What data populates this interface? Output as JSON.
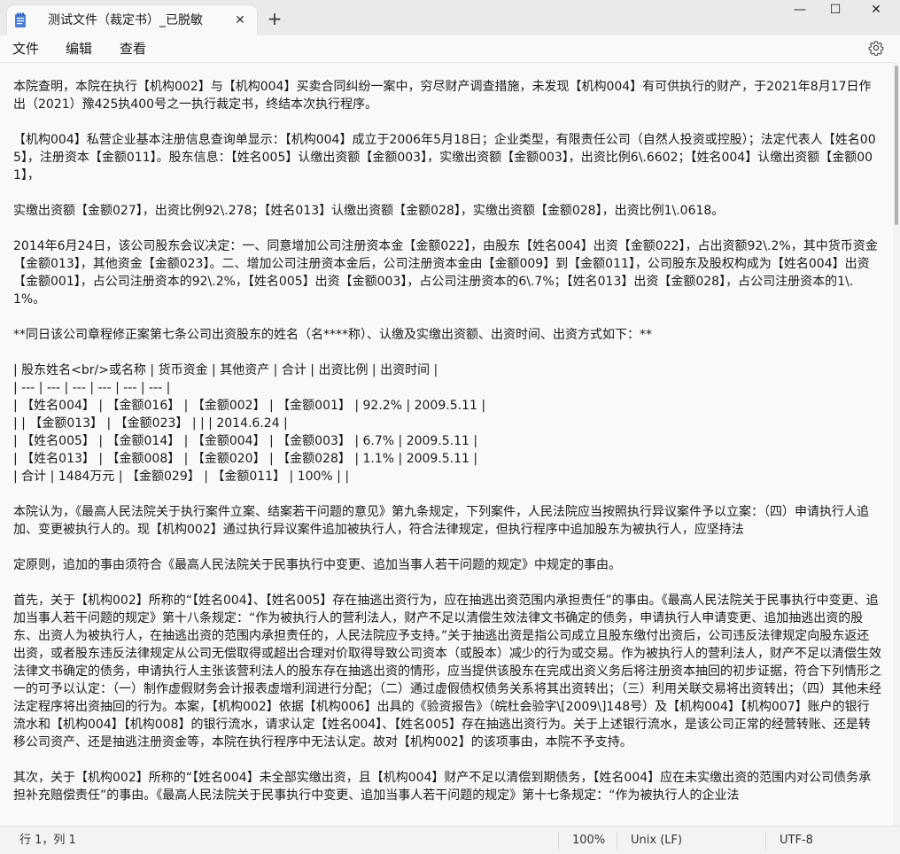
{
  "tab": {
    "title": "测试文件（裁定书）_已脱敏"
  },
  "window_controls": {
    "minimize": "—",
    "maximize": "☐",
    "close": "✕",
    "new_tab": "+",
    "tab_close": "✕"
  },
  "menu": {
    "file": "文件",
    "edit": "编辑",
    "view": "查看"
  },
  "icons": {
    "document": "notepad-document-icon",
    "settings": "gear-icon"
  },
  "document": {
    "paragraphs": [
      "本院查明，本院在执行【机构002】与【机构004】买卖合同纠纷一案中，穷尽财产调查措施，未发现【机构004】有可供执行的财产，于2021年8月17日作出（2021）豫425执400号之一执行裁定书，终结本次执行程序。",
      "【机构004】私营企业基本注册信息查询单显示：【机构004】成立于2006年5月18日；企业类型，有限责任公司（自然人投资或控股）；法定代表人【姓名005】，注册资本【金额011】。股东信息：【姓名005】认缴出资额【金额003】，实缴出资额【金额003】，出资比例6\\.6602；【姓名004】认缴出资额【金额001】，",
      "实缴出资额【金额027】，出资比例92\\.278；【姓名013】认缴出资额【金额028】，实缴出资额【金额028】，出资比例1\\.0618。",
      "2014年6月24日，该公司股东会议决定：一、同意增加公司注册资本金【金额022】，由股东【姓名004】出资【金额022】，占出资额92\\.2%，其中货币资金【金额013】，其他资金【金额023】。二、增加公司注册资本金后，公司注册资本金由【金额009】到【金额011】，公司股东及股权构成为【姓名004】出资【金额001】，占公司注册资本的92\\.2%，【姓名005】出资【金额003】，占公司注册资本的6\\.7%；【姓名013】出资【金额028】，占公司注册资本的1\\.1%。",
      "**同日该公司章程修正案第七条公司出资股东的姓名（名****称）、认缴及实缴出资额、出资时间、出资方式如下：**"
    ],
    "table_lines": [
      "| 股东姓名<br/>或名称 | 货币资金 | 其他资产 | 合计 | 出资比例 | 出资时间 |",
      "| --- | --- | --- | --- | --- | --- |",
      "| 【姓名004】 | 【金额016】 | 【金额002】 | 【金额001】 | 92.2% | 2009.5.11 |",
      "| | 【金额013】 | 【金额023】 | | | 2014.6.24 |",
      "| 【姓名005】 | 【金额014】 | 【金额004】 | 【金额003】 | 6.7% | 2009.5.11 |",
      "| 【姓名013】 | 【金额008】 | 【金额020】 | 【金额028】 | 1.1% | 2009.5.11 |",
      "| 合计 | 1484万元 | 【金额029】 | 【金额011】 | 100% | |"
    ],
    "paragraphs_after": [
      "本院认为，《最高人民法院关于执行案件立案、结案若干问题的意见》第九条规定，下列案件，人民法院应当按照执行异议案件予以立案：（四）申请执行人追加、变更被执行人的。现【机构002】通过执行异议案件追加被执行人，符合法律规定，但执行程序中追加股东为被执行人，应坚持法",
      "定原则，追加的事由须符合《最高人民法院关于民事执行中变更、追加当事人若干问题的规定》中规定的事由。",
      "首先，关于【机构002】所称的“【姓名004】、【姓名005】存在抽逃出资行为，应在抽逃出资范围内承担责任”的事由。《最高人民法院关于民事执行中变更、追加当事人若干问题的规定》第十八条规定：“作为被执行人的营利法人，财产不足以清偿生效法律文书确定的债务，申请执行人申请变更、追加抽逃出资的股东、出资人为被执行人，在抽逃出资的范围内承担责任的，人民法院应予支持。”关于抽逃出资是指公司成立且股东缴付出资后，公司违反法律规定向股东返还出资，或者股东违反法律规定从公司无偿取得或超出合理对价取得导致公司资本（或股本）减少的行为或交易。作为被执行人的营利法人，财产不足以清偿生效法律文书确定的债务，申请执行人主张该营利法人的股东存在抽逃出资的情形，应当提供该股东在完成出资义务后将注册资本抽回的初步证据，符合下列情形之一的可予以认定：（一）制作虚假财务会计报表虚增利润进行分配；（二）通过虚假债权债务关系将其出资转出；（三）利用关联交易将出资转出；（四）其他未经法定程序将出资抽回的行为。本案，【机构002】依据【机构006】出具的《验资报告》（皖杜会验字\\[2009\\]148号）及【机构004】【机构007】账户的银行流水和【机构004】【机构008】的银行流水，请求认定【姓名004】、【姓名005】存在抽逃出资行为。关于上述银行流水，是该公司正常的经营转账、还是转移公司资产、还是抽逃注册资金等，本院在执行程序中无法认定。故对【机构002】的该项事由，本院不予支持。",
      "其次，关于【机构002】所称的“【姓名004】未全部实缴出资，且【机构004】财产不足以清偿到期债务，【姓名004】应在未实缴出资的范围内对公司债务承担补充赔偿责任”的事由。《最高人民法院关于民事执行中变更、追加当事人若干问题的规定》第十七条规定：“作为被执行人的企业法"
    ]
  },
  "status": {
    "position": "行 1，列 1",
    "zoom": "100%",
    "line_ending": "Unix (LF)",
    "encoding": "UTF-8"
  }
}
